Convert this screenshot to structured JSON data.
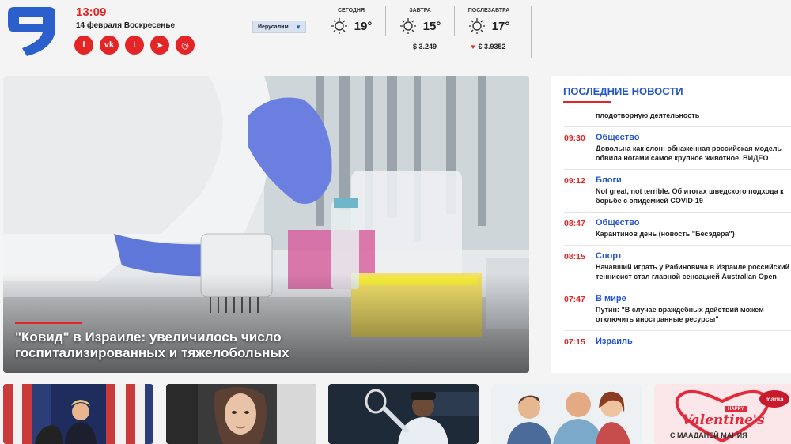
{
  "header": {
    "time": "13:09",
    "date": "14 февраля Воскресенье",
    "city": "Иерусалим",
    "weather": [
      {
        "label": "СЕГОДНЯ",
        "temp": "19°",
        "icon": "sun-icon"
      },
      {
        "label": "ЗАВТРА",
        "temp": "15°",
        "icon": "sun-icon"
      },
      {
        "label": "ПОСЛЕЗАВТРА",
        "temp": "17°",
        "icon": "sun-icon"
      }
    ],
    "currency": {
      "usd": "$ 3.249",
      "eur": "€ 3.9352",
      "eur_trend": "▼"
    },
    "socials": [
      "facebook-icon",
      "vk-icon",
      "twitter-icon",
      "telegram-icon",
      "instagram-icon"
    ],
    "social_glyphs": [
      "f",
      "vk",
      "t",
      "➤",
      "◎"
    ]
  },
  "hero": {
    "title": "\"Ковид\" в Израиле: увеличилось число госпитализированных и тяжелобольных"
  },
  "news": {
    "title": "ПОСЛЕДНИЕ НОВОСТИ",
    "items": [
      {
        "time": "",
        "category": "",
        "text": "плодотворную деятельность"
      },
      {
        "time": "09:30",
        "category": "Общество",
        "text": "Довольна как слон: обнаженная российская модель обвила ногами самое крупное животное. ВИДЕО"
      },
      {
        "time": "09:12",
        "category": "Блоги",
        "text": "Not great, not terrible. Об итогах шведского подхода к борьбе с эпидемией COVID-19"
      },
      {
        "time": "08:47",
        "category": "Общество",
        "text": "Карантинов день (новость \"Бесэдера\")"
      },
      {
        "time": "08:15",
        "category": "Спорт",
        "text": "Начавший играть у Рабиновича в Израиле российский теннисист стал главной сенсацией Australian Open"
      },
      {
        "time": "07:47",
        "category": "В мире",
        "text": "Путин: \"В случае враждебных действий можем отключить иностранные ресурсы\""
      },
      {
        "time": "07:15",
        "category": "Израиль",
        "text": ""
      }
    ]
  },
  "promo": {
    "happy": "HAPPY",
    "valentine": "Valentine's",
    "caption": "С МААДАНЕЙ МАНИЯ",
    "brand": "mania"
  },
  "colors": {
    "accent": "#e32527",
    "link": "#2456c8"
  }
}
